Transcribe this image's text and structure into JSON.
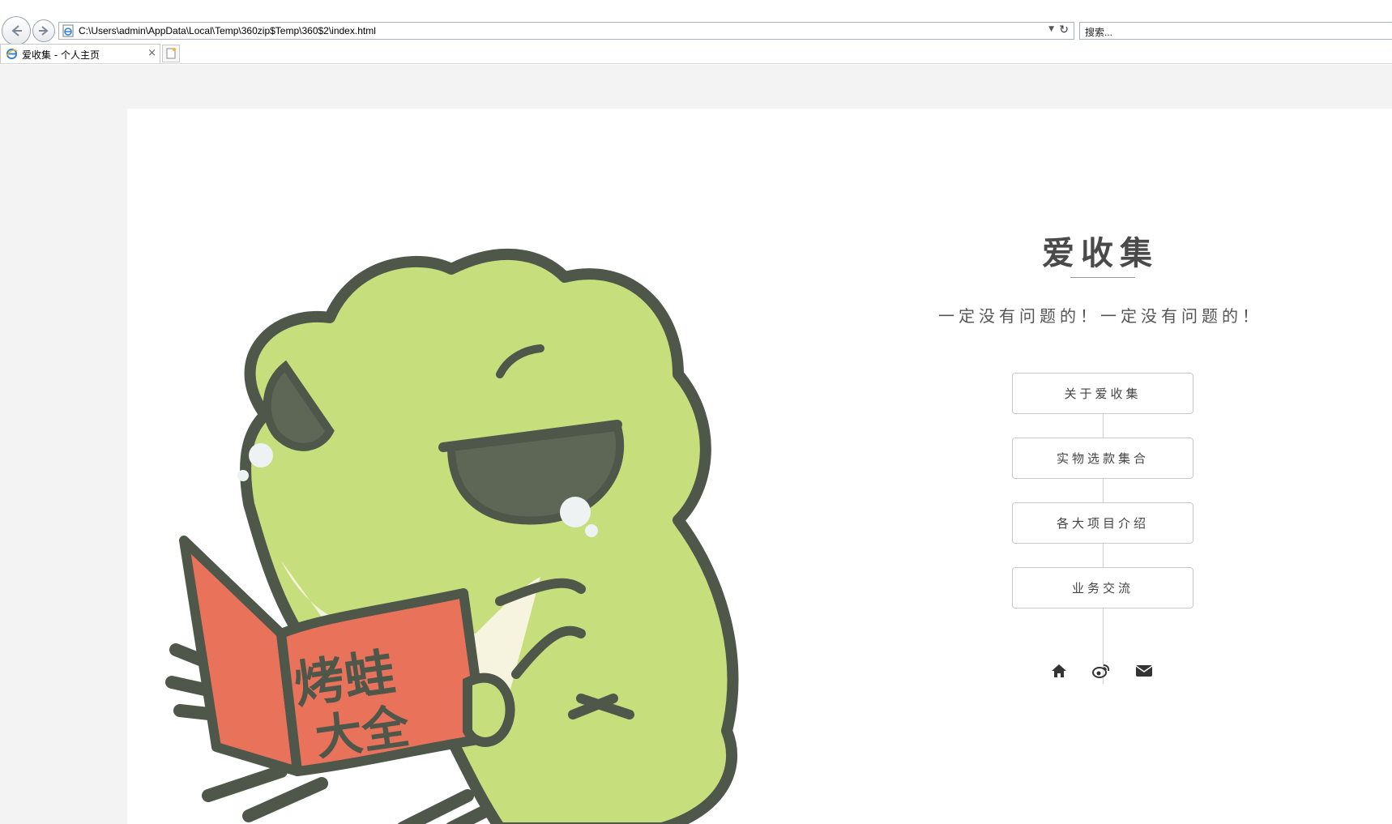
{
  "browser": {
    "address_url": "C:\\Users\\admin\\AppData\\Local\\Temp\\360zip$Temp\\360$2\\index.html",
    "search_placeholder": "搜索...",
    "tab_title": "爱收集 - 个人主页",
    "tab_close": "×"
  },
  "hero": {
    "book_title": "烤蛙大全"
  },
  "profile": {
    "title": "爱收集",
    "slogan": "一定没有问题的！一定没有问题的！",
    "menu": [
      {
        "label": "关于爱收集"
      },
      {
        "label": "实物选款集合"
      },
      {
        "label": "各大项目介绍"
      },
      {
        "label": "业务交流"
      }
    ],
    "social_icons": [
      "home-icon",
      "weibo-icon",
      "mail-icon"
    ]
  },
  "colors": {
    "frog_green": "#c7de7c",
    "outline": "#4f564a",
    "book_red": "#e8735a",
    "page_bg": "#f3f3f3"
  }
}
